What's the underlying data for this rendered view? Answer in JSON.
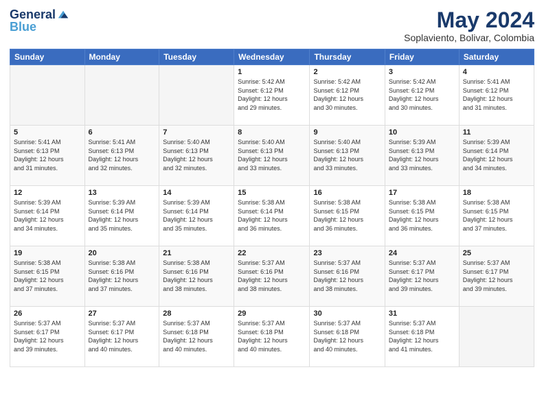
{
  "header": {
    "logo_line1": "General",
    "logo_line2": "Blue",
    "title": "May 2024",
    "subtitle": "Soplaviento, Bolivar, Colombia"
  },
  "days_of_week": [
    "Sunday",
    "Monday",
    "Tuesday",
    "Wednesday",
    "Thursday",
    "Friday",
    "Saturday"
  ],
  "weeks": [
    [
      {
        "day": "",
        "info": ""
      },
      {
        "day": "",
        "info": ""
      },
      {
        "day": "",
        "info": ""
      },
      {
        "day": "1",
        "info": "Sunrise: 5:42 AM\nSunset: 6:12 PM\nDaylight: 12 hours\nand 29 minutes."
      },
      {
        "day": "2",
        "info": "Sunrise: 5:42 AM\nSunset: 6:12 PM\nDaylight: 12 hours\nand 30 minutes."
      },
      {
        "day": "3",
        "info": "Sunrise: 5:42 AM\nSunset: 6:12 PM\nDaylight: 12 hours\nand 30 minutes."
      },
      {
        "day": "4",
        "info": "Sunrise: 5:41 AM\nSunset: 6:12 PM\nDaylight: 12 hours\nand 31 minutes."
      }
    ],
    [
      {
        "day": "5",
        "info": "Sunrise: 5:41 AM\nSunset: 6:13 PM\nDaylight: 12 hours\nand 31 minutes."
      },
      {
        "day": "6",
        "info": "Sunrise: 5:41 AM\nSunset: 6:13 PM\nDaylight: 12 hours\nand 32 minutes."
      },
      {
        "day": "7",
        "info": "Sunrise: 5:40 AM\nSunset: 6:13 PM\nDaylight: 12 hours\nand 32 minutes."
      },
      {
        "day": "8",
        "info": "Sunrise: 5:40 AM\nSunset: 6:13 PM\nDaylight: 12 hours\nand 33 minutes."
      },
      {
        "day": "9",
        "info": "Sunrise: 5:40 AM\nSunset: 6:13 PM\nDaylight: 12 hours\nand 33 minutes."
      },
      {
        "day": "10",
        "info": "Sunrise: 5:39 AM\nSunset: 6:13 PM\nDaylight: 12 hours\nand 33 minutes."
      },
      {
        "day": "11",
        "info": "Sunrise: 5:39 AM\nSunset: 6:14 PM\nDaylight: 12 hours\nand 34 minutes."
      }
    ],
    [
      {
        "day": "12",
        "info": "Sunrise: 5:39 AM\nSunset: 6:14 PM\nDaylight: 12 hours\nand 34 minutes."
      },
      {
        "day": "13",
        "info": "Sunrise: 5:39 AM\nSunset: 6:14 PM\nDaylight: 12 hours\nand 35 minutes."
      },
      {
        "day": "14",
        "info": "Sunrise: 5:39 AM\nSunset: 6:14 PM\nDaylight: 12 hours\nand 35 minutes."
      },
      {
        "day": "15",
        "info": "Sunrise: 5:38 AM\nSunset: 6:14 PM\nDaylight: 12 hours\nand 36 minutes."
      },
      {
        "day": "16",
        "info": "Sunrise: 5:38 AM\nSunset: 6:15 PM\nDaylight: 12 hours\nand 36 minutes."
      },
      {
        "day": "17",
        "info": "Sunrise: 5:38 AM\nSunset: 6:15 PM\nDaylight: 12 hours\nand 36 minutes."
      },
      {
        "day": "18",
        "info": "Sunrise: 5:38 AM\nSunset: 6:15 PM\nDaylight: 12 hours\nand 37 minutes."
      }
    ],
    [
      {
        "day": "19",
        "info": "Sunrise: 5:38 AM\nSunset: 6:15 PM\nDaylight: 12 hours\nand 37 minutes."
      },
      {
        "day": "20",
        "info": "Sunrise: 5:38 AM\nSunset: 6:16 PM\nDaylight: 12 hours\nand 37 minutes."
      },
      {
        "day": "21",
        "info": "Sunrise: 5:38 AM\nSunset: 6:16 PM\nDaylight: 12 hours\nand 38 minutes."
      },
      {
        "day": "22",
        "info": "Sunrise: 5:37 AM\nSunset: 6:16 PM\nDaylight: 12 hours\nand 38 minutes."
      },
      {
        "day": "23",
        "info": "Sunrise: 5:37 AM\nSunset: 6:16 PM\nDaylight: 12 hours\nand 38 minutes."
      },
      {
        "day": "24",
        "info": "Sunrise: 5:37 AM\nSunset: 6:17 PM\nDaylight: 12 hours\nand 39 minutes."
      },
      {
        "day": "25",
        "info": "Sunrise: 5:37 AM\nSunset: 6:17 PM\nDaylight: 12 hours\nand 39 minutes."
      }
    ],
    [
      {
        "day": "26",
        "info": "Sunrise: 5:37 AM\nSunset: 6:17 PM\nDaylight: 12 hours\nand 39 minutes."
      },
      {
        "day": "27",
        "info": "Sunrise: 5:37 AM\nSunset: 6:17 PM\nDaylight: 12 hours\nand 40 minutes."
      },
      {
        "day": "28",
        "info": "Sunrise: 5:37 AM\nSunset: 6:18 PM\nDaylight: 12 hours\nand 40 minutes."
      },
      {
        "day": "29",
        "info": "Sunrise: 5:37 AM\nSunset: 6:18 PM\nDaylight: 12 hours\nand 40 minutes."
      },
      {
        "day": "30",
        "info": "Sunrise: 5:37 AM\nSunset: 6:18 PM\nDaylight: 12 hours\nand 40 minutes."
      },
      {
        "day": "31",
        "info": "Sunrise: 5:37 AM\nSunset: 6:18 PM\nDaylight: 12 hours\nand 41 minutes."
      },
      {
        "day": "",
        "info": ""
      }
    ]
  ]
}
